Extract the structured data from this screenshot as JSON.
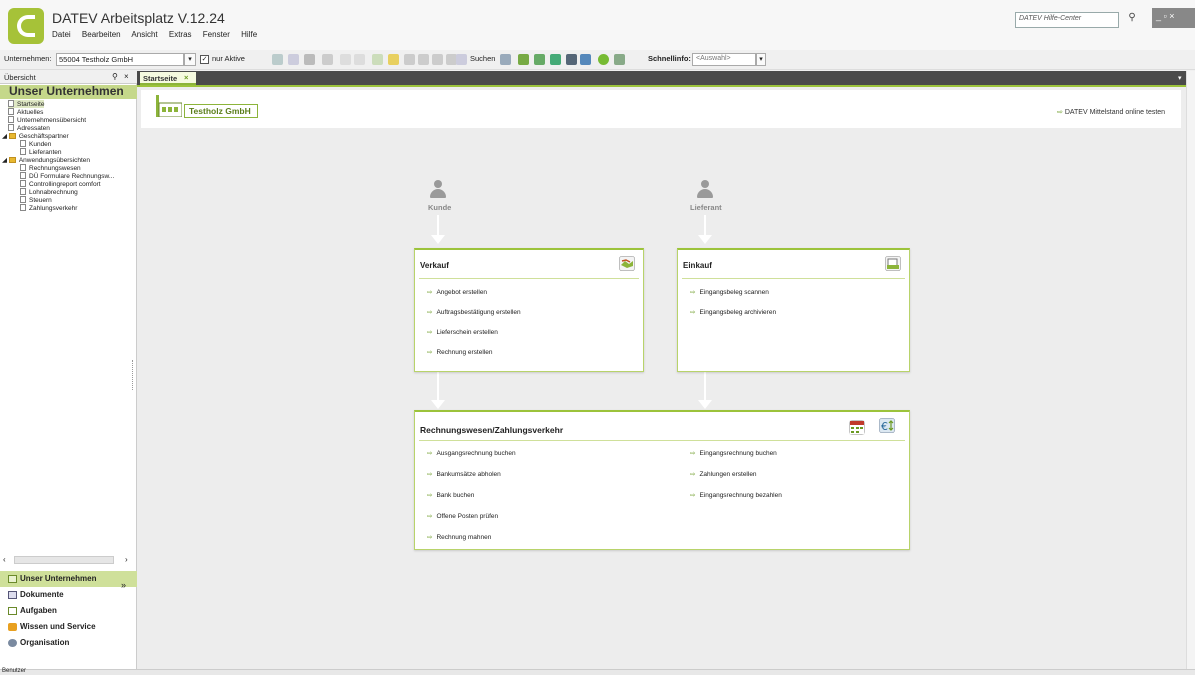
{
  "app": {
    "title": "DATEV Arbeitsplatz V.12.24",
    "menu": [
      "Datei",
      "Bearbeiten",
      "Ansicht",
      "Extras",
      "Fenster",
      "Hilfe"
    ],
    "help_search_placeholder": "DATEV Hilfe-Center",
    "window_controls": "_ ▫ ×"
  },
  "toolbar": {
    "company_label": "Unternehmen:",
    "company_value": "55004 Testholz GmbH",
    "nur_aktive_label": "nur Aktive",
    "suchen_label": "Suchen",
    "schnellinfo_label": "Schnellinfo:",
    "schnellinfo_value": "<Auswahl>"
  },
  "left_panel": {
    "header": "Übersicht",
    "title": "Unser Unternehmen",
    "tree": [
      "Startseite",
      "Aktuelles",
      "Unternehmensübersicht",
      "Adressaten",
      "Geschäftspartner",
      "Kunden",
      "Lieferanten",
      "Anwendungsübersichten",
      "Rechnungswesen",
      "DÜ Formulare Rechnungsw...",
      "Controllingreport comfort",
      "Lohnabrechnung",
      "Steuern",
      "Zahlungsverkehr"
    ],
    "nav": [
      "Unser Unternehmen",
      "Dokumente",
      "Aufgaben",
      "Wissen und Service",
      "Organisation"
    ],
    "more": "»",
    "status": "Benutzer"
  },
  "tabs": {
    "active": "Startseite"
  },
  "home": {
    "company": "Testholz GmbH",
    "online_link": "DATEV Mittelstand online testen",
    "customer_label": "Kunde",
    "supplier_label": "Lieferant",
    "verkauf": {
      "title": "Verkauf",
      "links": [
        "Angebot erstellen",
        "Auftragsbestätigung erstellen",
        "Lieferschein erstellen",
        "Rechnung erstellen"
      ]
    },
    "einkauf": {
      "title": "Einkauf",
      "links": [
        "Eingangsbeleg scannen",
        "Eingangsbeleg archivieren"
      ]
    },
    "rewe": {
      "title": "Rechnungswesen/Zahlungsverkehr",
      "links_left": [
        "Ausgangsrechnung buchen",
        "Bankumsätze abholen",
        "Bank buchen",
        "Offene Posten prüfen",
        "Rechnung mahnen"
      ],
      "links_right": [
        "Eingangsrechnung buchen",
        "Zahlungen erstellen",
        "Eingangsrechnung bezahlen"
      ]
    }
  },
  "colors": {
    "accent": "#9cc33b",
    "accent_light": "#cfe09a",
    "tabstrip": "#4a4a4a"
  }
}
